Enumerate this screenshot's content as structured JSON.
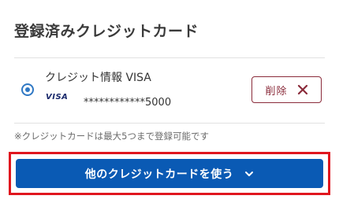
{
  "section": {
    "title": "登録済みクレジットカード"
  },
  "card": {
    "name": "クレジット情報 VISA",
    "brand": "VISA",
    "number": "************5000",
    "selected": true
  },
  "delete_button": {
    "label": "削除",
    "icon": "close-icon"
  },
  "note": "※クレジットカードは最大5つまで登録可能です",
  "other_card_button": {
    "label": "他のクレジットカードを使う",
    "icon": "chevron-down-icon"
  },
  "colors": {
    "primary": "#0a5ab4",
    "radio": "#2f78c4",
    "delete": "#8a2b3a",
    "highlight": "#e0161e",
    "visa": "#1a2a6c"
  }
}
